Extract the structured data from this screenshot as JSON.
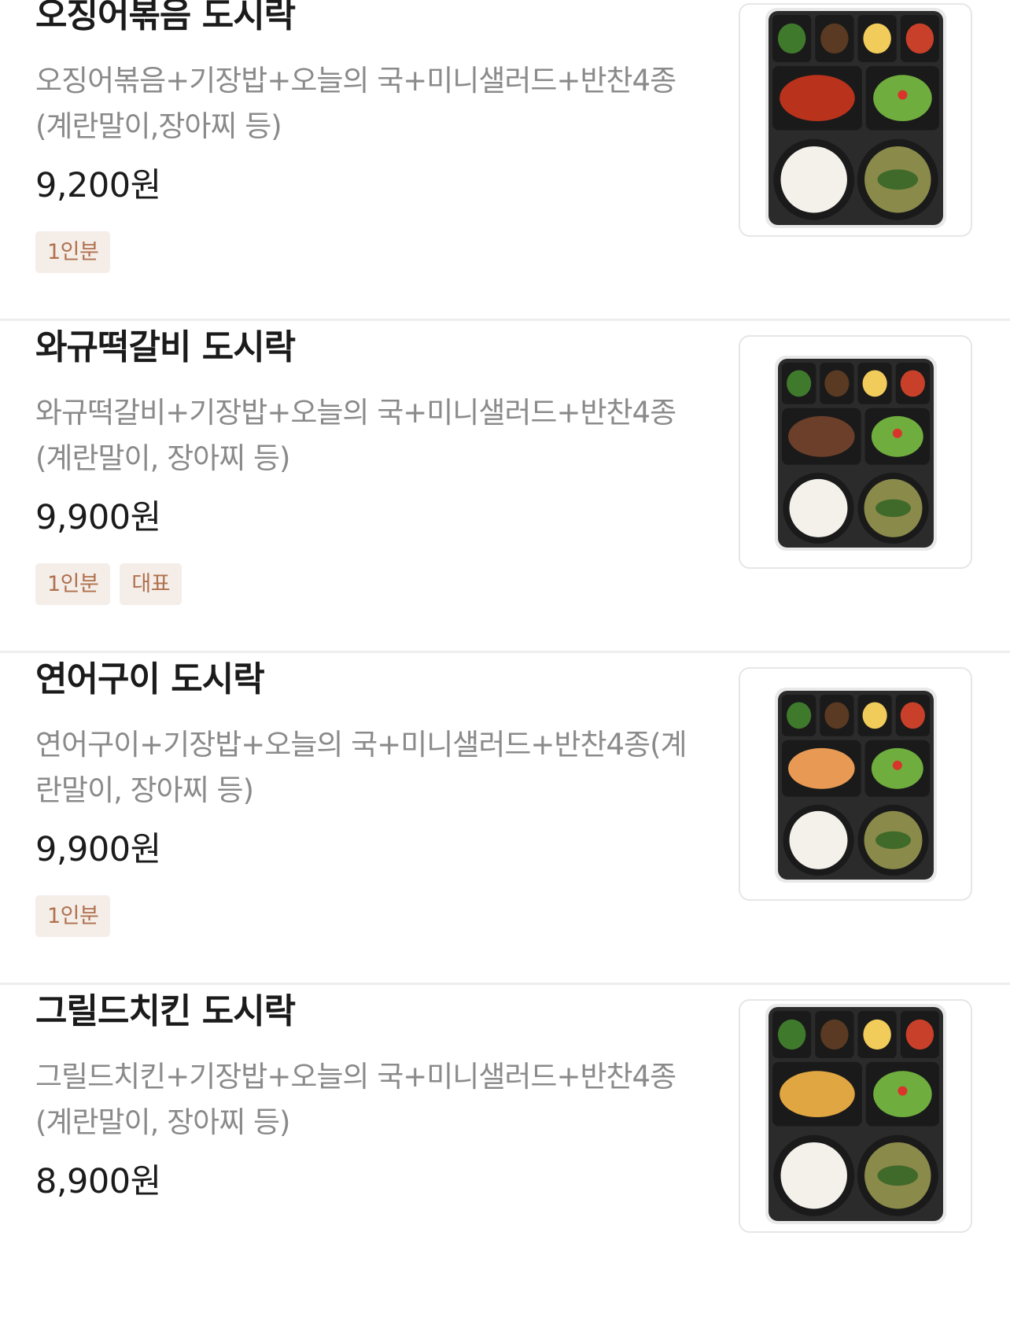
{
  "menu": {
    "items": [
      {
        "name": "오징어볶음 도시락",
        "description": "오징어볶음+기장밥+오늘의 국+미니샐러드+반찬4종(계란말이,장아찌 등)",
        "desc_line1": "오징어볶음+기장밥+오늘의 국+미니샐러드+반찬4종",
        "desc_line2": "(계란말이,장아찌 등)",
        "price": "9,200원",
        "badges": [
          "1인분"
        ],
        "image": "dosirak-squid-image",
        "main_color": "#b8321c"
      },
      {
        "name": "와규떡갈비 도시락",
        "description": "와규떡갈비+기장밥+오늘의 국+미니샐러드+반찬4종(계란말이, 장아찌 등)",
        "desc_line1": "와규떡갈비+기장밥+오늘의 국+미니샐러드+반찬4종",
        "desc_line2": "(계란말이, 장아찌 등)",
        "price": "9,900원",
        "badges": [
          "1인분",
          "대표"
        ],
        "image": "dosirak-wagyu-image",
        "main_color": "#6b3f2a"
      },
      {
        "name": "연어구이 도시락",
        "description": "연어구이+기장밥+오늘의 국+미니샐러드+반찬4종(계란말이, 장아찌 등)",
        "desc_line1": "연어구이+기장밥+오늘의 국+미니샐러드+반찬4종(계",
        "desc_line2": "란말이, 장아찌 등)",
        "price": "9,900원",
        "badges": [
          "1인분"
        ],
        "image": "dosirak-salmon-image",
        "main_color": "#e89a55"
      },
      {
        "name": "그릴드치킨 도시락",
        "description": "그릴드치킨+기장밥+오늘의 국+미니샐러드+반찬4종(계란말이, 장아찌 등)",
        "desc_line1": "그릴드치킨+기장밥+오늘의 국+미니샐러드+반찬4종",
        "desc_line2": "(계란말이, 장아찌 등)",
        "price": "8,900원",
        "badges": [],
        "image": "dosirak-chicken-image",
        "main_color": "#e0a642"
      }
    ]
  },
  "colors": {
    "badge_bg": "#f4ede8",
    "badge_text": "#b0714e",
    "desc_text": "#8a8a8a",
    "divider": "#eeeeee"
  }
}
